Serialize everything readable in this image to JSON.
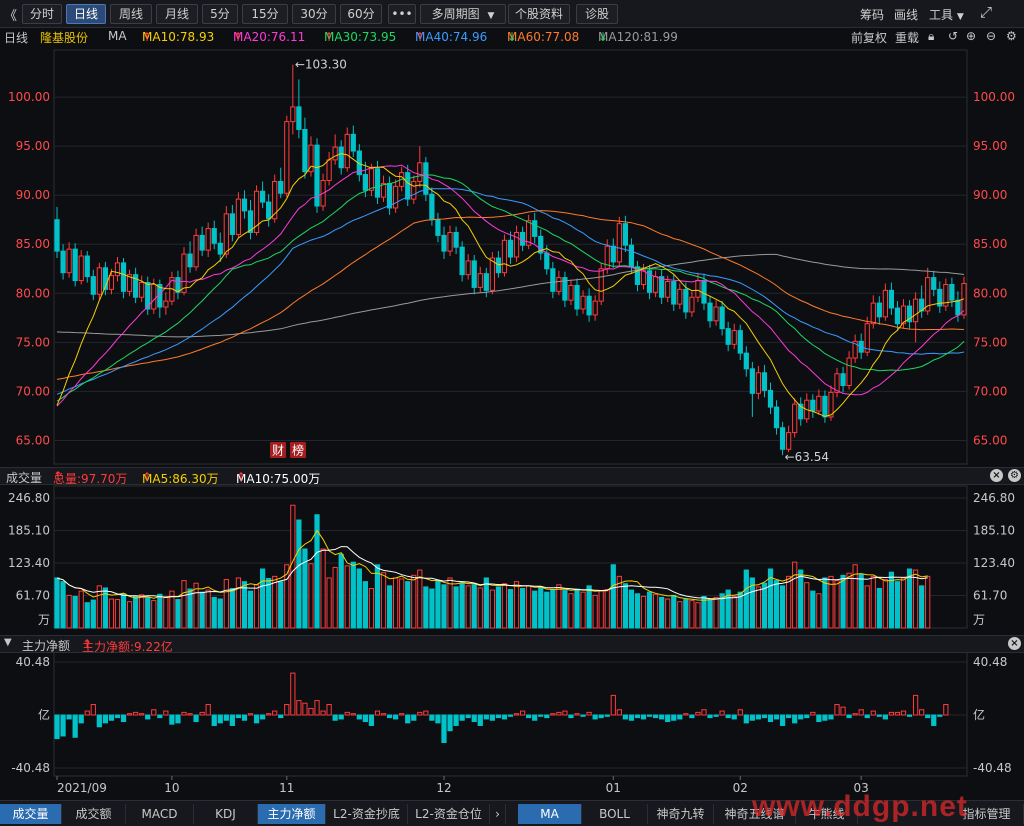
{
  "toolbar": {
    "back_glyph": "《",
    "periods": [
      "分时",
      "日线",
      "周线",
      "月线",
      "5分",
      "15分",
      "30分",
      "60分"
    ],
    "active_period": "日线",
    "more": "•••",
    "multi_period": "多周期图",
    "stock_info": "个股资料",
    "diagnose": "诊股",
    "right": {
      "chips": "筹码",
      "draw": "画线",
      "tools": "工具"
    }
  },
  "info": {
    "period": "日线",
    "stock_name": "隆基股份",
    "ma_label": "MA",
    "ma10": "MA10:78.93",
    "ma20": "MA20:76.11",
    "ma30": "MA30:73.95",
    "ma40": "MA40:74.96",
    "ma60": "MA60:77.08",
    "ma120": "MA120:81.99",
    "adjust": "前复权",
    "replay": "重载"
  },
  "colors": {
    "up": "#ff3b3b",
    "down": "#00c2c8",
    "ma5": "#ffffff",
    "ma10": "#f5d000",
    "ma20": "#ff3ad8",
    "ma30": "#1ed760",
    "ma40": "#3a9cff",
    "ma60": "#ff7a2a",
    "ma120": "#9a9a9a",
    "axis_up_text": "#ff4a4a"
  },
  "chart_data": [
    {
      "type": "candlestick",
      "title": "隆基股份 日线",
      "y_ticks": [
        "100.00",
        "95.00",
        "90.00",
        "85.00",
        "80.00",
        "75.00",
        "70.00",
        "65.00"
      ],
      "ylim": [
        62.6,
        104.8
      ],
      "high_label": "←103.30",
      "low_label": "←63.54",
      "high": 103.3,
      "low": 63.54,
      "markers": [
        "财",
        "榜"
      ],
      "x_ticks": [
        "2021/09",
        "10",
        "11",
        "12",
        "01",
        "02",
        "03"
      ],
      "x_tick_index": [
        0,
        19,
        38,
        64,
        92,
        113,
        133
      ],
      "candles": [
        [
          87.5,
          84.3,
          88.8,
          83.6
        ],
        [
          84.3,
          82.1,
          85.0,
          81.4
        ],
        [
          82.1,
          84.5,
          85.2,
          81.6
        ],
        [
          84.5,
          81.3,
          85.1,
          80.7
        ],
        [
          81.3,
          83.8,
          84.4,
          80.9
        ],
        [
          83.8,
          81.7,
          84.3,
          81.1
        ],
        [
          81.7,
          79.9,
          82.4,
          79.3
        ],
        [
          79.9,
          82.6,
          83.1,
          79.4
        ],
        [
          82.6,
          80.4,
          83.2,
          79.8
        ],
        [
          80.4,
          81.8,
          82.5,
          79.9
        ],
        [
          81.8,
          83.1,
          83.7,
          81.2
        ],
        [
          83.1,
          80.2,
          83.6,
          79.5
        ],
        [
          80.2,
          81.9,
          82.4,
          79.7
        ],
        [
          81.9,
          79.6,
          82.6,
          79.0
        ],
        [
          79.6,
          81.1,
          81.8,
          79.1
        ],
        [
          81.1,
          78.4,
          81.7,
          77.8
        ],
        [
          78.4,
          80.9,
          81.5,
          77.9
        ],
        [
          80.9,
          78.6,
          81.4,
          77.5
        ],
        [
          78.6,
          79.2,
          80.1,
          77.8
        ],
        [
          79.2,
          81.6,
          82.2,
          78.8
        ],
        [
          81.6,
          80.1,
          82.3,
          79.4
        ],
        [
          80.1,
          84.0,
          84.7,
          79.8
        ],
        [
          84.0,
          82.7,
          85.3,
          82.1
        ],
        [
          82.7,
          85.9,
          86.6,
          82.3
        ],
        [
          85.9,
          84.4,
          86.8,
          83.8
        ],
        [
          84.4,
          86.6,
          87.2,
          83.7
        ],
        [
          86.6,
          85.1,
          87.4,
          84.5
        ],
        [
          85.1,
          84.0,
          86.2,
          83.2
        ],
        [
          84.0,
          88.1,
          88.9,
          83.6
        ],
        [
          88.1,
          86.0,
          89.0,
          85.3
        ],
        [
          86.0,
          89.6,
          90.3,
          85.7
        ],
        [
          89.6,
          88.4,
          90.5,
          87.6
        ],
        [
          88.4,
          86.2,
          89.5,
          85.5
        ],
        [
          86.2,
          90.4,
          91.0,
          85.9
        ],
        [
          90.4,
          89.3,
          91.4,
          88.7
        ],
        [
          89.3,
          87.6,
          90.1,
          86.8
        ],
        [
          87.6,
          91.4,
          92.1,
          87.2
        ],
        [
          91.4,
          90.2,
          92.8,
          89.7
        ],
        [
          90.2,
          97.5,
          98.1,
          89.8
        ],
        [
          97.5,
          99.0,
          103.3,
          96.2
        ],
        [
          99.0,
          96.7,
          101.8,
          95.8
        ],
        [
          96.7,
          92.4,
          97.9,
          91.7
        ],
        [
          92.4,
          95.1,
          96.0,
          91.9
        ],
        [
          95.1,
          88.9,
          95.8,
          88.2
        ],
        [
          88.9,
          91.5,
          92.2,
          88.4
        ],
        [
          91.5,
          93.6,
          94.4,
          91.0
        ],
        [
          93.6,
          94.9,
          96.2,
          93.1
        ],
        [
          94.9,
          92.8,
          95.6,
          92.1
        ],
        [
          92.8,
          96.2,
          96.9,
          92.4
        ],
        [
          96.2,
          94.5,
          97.1,
          93.9
        ],
        [
          94.5,
          92.1,
          95.2,
          91.4
        ],
        [
          92.1,
          90.5,
          93.4,
          89.8
        ],
        [
          90.5,
          92.7,
          93.2,
          89.9
        ],
        [
          92.7,
          89.8,
          93.5,
          89.1
        ],
        [
          89.8,
          91.2,
          92.0,
          89.3
        ],
        [
          91.2,
          88.7,
          91.9,
          88.0
        ],
        [
          88.7,
          90.9,
          91.6,
          88.2
        ],
        [
          90.9,
          92.3,
          92.9,
          90.4
        ],
        [
          92.3,
          89.6,
          93.1,
          88.9
        ],
        [
          89.6,
          91.4,
          92.0,
          89.1
        ],
        [
          91.4,
          93.3,
          95.0,
          90.8
        ],
        [
          93.3,
          90.1,
          93.9,
          89.4
        ],
        [
          90.1,
          87.5,
          90.8,
          86.9
        ],
        [
          87.5,
          85.9,
          88.2,
          85.2
        ],
        [
          85.9,
          84.3,
          86.8,
          83.5
        ],
        [
          84.3,
          86.2,
          86.9,
          83.8
        ],
        [
          86.2,
          84.7,
          86.8,
          84.0
        ],
        [
          84.7,
          81.9,
          85.3,
          81.2
        ],
        [
          81.9,
          83.3,
          84.0,
          81.4
        ],
        [
          83.3,
          80.6,
          83.9,
          79.9
        ],
        [
          80.6,
          82.0,
          82.7,
          80.1
        ],
        [
          82.0,
          80.3,
          82.6,
          79.6
        ],
        [
          80.3,
          83.6,
          84.2,
          79.9
        ],
        [
          83.6,
          82.1,
          84.3,
          81.6
        ],
        [
          82.1,
          85.4,
          86.0,
          81.7
        ],
        [
          85.4,
          83.7,
          86.3,
          83.0
        ],
        [
          83.7,
          86.2,
          86.9,
          83.2
        ],
        [
          86.2,
          84.9,
          86.8,
          84.3
        ],
        [
          84.9,
          87.4,
          88.0,
          84.5
        ],
        [
          87.4,
          85.8,
          88.2,
          85.1
        ],
        [
          85.8,
          84.1,
          86.5,
          83.4
        ],
        [
          84.1,
          82.5,
          84.9,
          81.9
        ],
        [
          82.5,
          80.2,
          83.2,
          79.5
        ],
        [
          80.2,
          81.6,
          82.3,
          79.8
        ],
        [
          81.6,
          79.3,
          82.2,
          78.6
        ],
        [
          79.3,
          80.8,
          81.4,
          78.8
        ],
        [
          80.8,
          78.4,
          81.5,
          77.7
        ],
        [
          78.4,
          79.7,
          80.3,
          77.9
        ],
        [
          79.7,
          77.8,
          80.5,
          77.1
        ],
        [
          77.8,
          79.2,
          79.8,
          77.2
        ],
        [
          79.2,
          82.5,
          83.1,
          78.8
        ],
        [
          82.5,
          84.8,
          85.5,
          82.0
        ],
        [
          84.8,
          83.2,
          85.6,
          82.6
        ],
        [
          83.2,
          87.1,
          87.8,
          82.7
        ],
        [
          87.1,
          84.9,
          87.9,
          84.2
        ],
        [
          84.9,
          82.7,
          85.6,
          82.0
        ],
        [
          82.7,
          80.9,
          83.3,
          80.2
        ],
        [
          80.9,
          82.3,
          83.0,
          80.4
        ],
        [
          82.3,
          80.1,
          82.9,
          79.4
        ],
        [
          80.1,
          81.7,
          82.3,
          79.6
        ],
        [
          81.7,
          79.6,
          82.4,
          78.9
        ],
        [
          79.6,
          81.2,
          81.8,
          79.1
        ],
        [
          81.2,
          78.9,
          81.9,
          78.2
        ],
        [
          78.9,
          80.4,
          81.0,
          78.4
        ],
        [
          80.4,
          78.1,
          81.1,
          77.4
        ],
        [
          78.1,
          79.6,
          80.2,
          77.6
        ],
        [
          79.6,
          81.3,
          82.1,
          79.1
        ],
        [
          81.3,
          79.0,
          82.0,
          78.3
        ],
        [
          79.0,
          77.2,
          79.7,
          76.5
        ],
        [
          77.2,
          78.6,
          79.3,
          76.7
        ],
        [
          78.6,
          76.4,
          79.2,
          75.7
        ],
        [
          76.4,
          74.8,
          77.1,
          74.1
        ],
        [
          74.8,
          76.2,
          76.9,
          74.3
        ],
        [
          76.2,
          73.9,
          76.8,
          73.2
        ],
        [
          73.9,
          72.3,
          74.6,
          71.5
        ],
        [
          72.3,
          69.8,
          73.0,
          67.4
        ],
        [
          69.8,
          71.9,
          72.6,
          69.2
        ],
        [
          71.9,
          70.1,
          72.7,
          69.4
        ],
        [
          70.1,
          68.4,
          70.9,
          67.7
        ],
        [
          68.4,
          66.3,
          69.1,
          65.6
        ],
        [
          66.3,
          64.1,
          66.9,
          63.5
        ],
        [
          64.1,
          65.8,
          66.5,
          63.8
        ],
        [
          65.8,
          68.7,
          69.3,
          65.3
        ],
        [
          68.7,
          67.2,
          69.4,
          66.5
        ],
        [
          67.2,
          69.1,
          69.8,
          66.8
        ],
        [
          69.1,
          68.0,
          69.7,
          67.3
        ],
        [
          68.0,
          69.5,
          70.2,
          67.6
        ],
        [
          69.5,
          67.4,
          70.1,
          66.8
        ],
        [
          67.4,
          69.9,
          70.6,
          67.0
        ],
        [
          69.9,
          71.8,
          72.4,
          69.4
        ],
        [
          71.8,
          70.6,
          72.5,
          69.9
        ],
        [
          70.6,
          73.4,
          74.1,
          70.2
        ],
        [
          73.4,
          75.1,
          75.8,
          72.9
        ],
        [
          75.1,
          74.0,
          75.9,
          73.3
        ],
        [
          74.0,
          76.9,
          77.6,
          73.6
        ],
        [
          76.9,
          79.0,
          79.8,
          76.4
        ],
        [
          79.0,
          77.6,
          79.7,
          76.8
        ],
        [
          77.6,
          80.3,
          81.0,
          77.2
        ],
        [
          80.3,
          78.5,
          81.1,
          77.8
        ],
        [
          78.5,
          76.9,
          79.2,
          76.2
        ],
        [
          76.9,
          78.7,
          79.4,
          76.4
        ],
        [
          78.7,
          77.1,
          79.3,
          76.3
        ],
        [
          77.1,
          79.4,
          80.1,
          75.0
        ],
        [
          79.4,
          78.2,
          80.8,
          77.5
        ],
        [
          78.2,
          81.6,
          82.6,
          77.8
        ],
        [
          81.6,
          80.4,
          82.3,
          79.7
        ],
        [
          80.4,
          78.7,
          81.2,
          78.0
        ],
        [
          78.7,
          80.9,
          81.5,
          78.2
        ],
        [
          80.9,
          79.3,
          81.6,
          78.6
        ],
        [
          79.3,
          77.8,
          80.2,
          77.1
        ],
        [
          77.8,
          81.0,
          81.7,
          77.4
        ]
      ]
    },
    {
      "type": "bar",
      "title": "成交量",
      "legend": {
        "total": "总量:97.70万",
        "ma5": "MA5:86.30万",
        "ma10": "MA10:75.00万"
      },
      "y_ticks": [
        "246.80",
        "185.10",
        "123.40",
        "61.70"
      ],
      "unit": "万",
      "ylim": [
        0,
        246.8
      ],
      "values": [
        95,
        88,
        62,
        60,
        70,
        48,
        53,
        80,
        76,
        55,
        54,
        65,
        50,
        60,
        63,
        58,
        52,
        64,
        58,
        70,
        54,
        90,
        74,
        85,
        68,
        72,
        58,
        55,
        92,
        75,
        95,
        88,
        70,
        82,
        112,
        94,
        98,
        88,
        120,
        233,
        205,
        150,
        122,
        215,
        150,
        95,
        115,
        140,
        118,
        125,
        112,
        88,
        75,
        120,
        105,
        80,
        95,
        93,
        88,
        100,
        110,
        78,
        74,
        90,
        82,
        95,
        78,
        86,
        80,
        82,
        76,
        95,
        72,
        78,
        84,
        73,
        88,
        75,
        80,
        70,
        76,
        68,
        72,
        82,
        71,
        65,
        74,
        68,
        80,
        62,
        70,
        73,
        120,
        98,
        84,
        72,
        65,
        60,
        68,
        64,
        58,
        55,
        62,
        50,
        54,
        52,
        48,
        60,
        55,
        58,
        65,
        72,
        60,
        68,
        110,
        95,
        78,
        85,
        112,
        90,
        80,
        98,
        125,
        110,
        86,
        70,
        65,
        95,
        98,
        90,
        100,
        104,
        120,
        102,
        80,
        98,
        75,
        92,
        106,
        88,
        95,
        112,
        110,
        80,
        98
      ]
    },
    {
      "type": "bar",
      "title": "主力净额",
      "legend": {
        "net": "主力净额:9.22亿"
      },
      "y_ticks": [
        "40.48",
        "亿",
        "-40.48"
      ],
      "ylim": [
        -40.48,
        40.48
      ],
      "values": [
        -18,
        -16,
        -3,
        -17,
        -6,
        3,
        8,
        -9,
        -6,
        -4,
        -2,
        -5,
        1,
        2,
        1,
        -3,
        4,
        -2,
        3,
        -7,
        -6,
        2,
        1,
        -5,
        2,
        8,
        -8,
        -6,
        -4,
        -8,
        -2,
        -4,
        1,
        -6,
        -3,
        1,
        3,
        -2,
        8,
        32,
        11,
        9,
        5,
        11,
        3,
        8,
        -4,
        -3,
        2,
        1,
        -3,
        -5,
        -8,
        3,
        1,
        -2,
        -3,
        1,
        -6,
        -4,
        2,
        3,
        -4,
        -6,
        -21,
        -12,
        -8,
        -4,
        -2,
        -5,
        -8,
        -3,
        -4,
        -2,
        -3,
        -1,
        1,
        3,
        -2,
        -4,
        -1,
        -2,
        1,
        2,
        3,
        -2,
        1,
        -1,
        2,
        -3,
        -2,
        -1,
        15,
        4,
        -3,
        -4,
        -2,
        -3,
        -1,
        -2,
        -3,
        -5,
        -4,
        -3,
        1,
        -2,
        2,
        4,
        -2,
        -1,
        3,
        -2,
        -3,
        4,
        -6,
        -4,
        -3,
        -2,
        -5,
        -3,
        -8,
        -2,
        -6,
        -3,
        -2,
        2,
        -5,
        -4,
        -3,
        8,
        6,
        -2,
        1,
        4,
        -2,
        3,
        -1,
        -3,
        2,
        2,
        3,
        -1,
        15,
        4,
        -2,
        -8,
        -1,
        8
      ]
    }
  ],
  "bottom_tabs": [
    "成交量",
    "成交额",
    "MACD",
    "KDJ",
    "主力净额",
    "L2-资金抄底",
    "L2-资金仓位",
    "›",
    "MA",
    "BOLL",
    "神奇九转",
    "神奇五线谱",
    "牛熊线",
    "指标管理"
  ],
  "watermark": "www.ddgp.net"
}
